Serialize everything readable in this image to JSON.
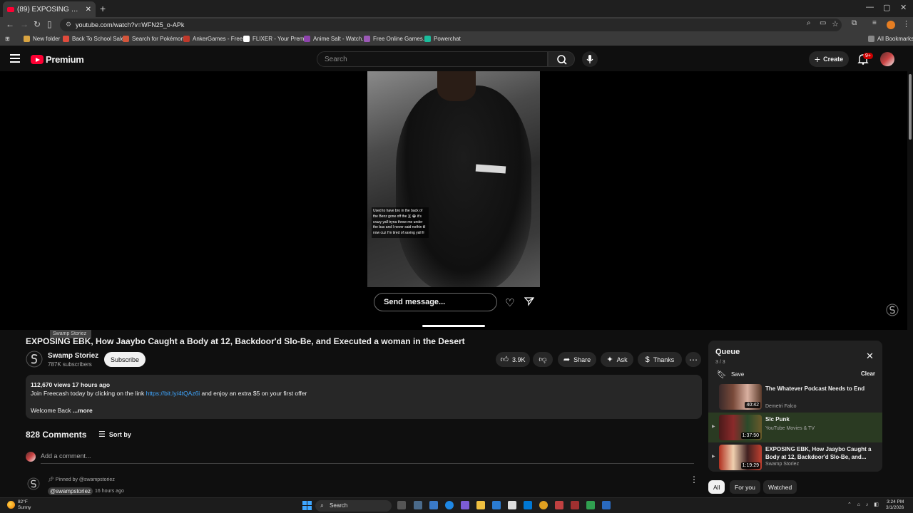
{
  "browser": {
    "tab_title": "(89) EXPOSING EBK, How Jaaybo Caug",
    "url": "youtube.com/watch?v=WFN25_o-APk",
    "new_tab_symbol": "+",
    "bookmarks": [
      {
        "label": "New folder",
        "color": "#d9a441"
      },
      {
        "label": "Back To School Sale...",
        "color": "#e04b3c"
      },
      {
        "label": "Search for Pokémon...",
        "color": "#d4553b"
      },
      {
        "label": "AnkerGames - Free...",
        "color": "#c0392b"
      },
      {
        "label": "FLIXER - Your Premi...",
        "color": "#ffffff"
      },
      {
        "label": "Anime Salt - Watch...",
        "color": "#8e44ad"
      },
      {
        "label": "Free Online Games...",
        "color": "#9b59b6"
      },
      {
        "label": "Powerchat",
        "color": "#1abc9c"
      }
    ],
    "all_bookmarks": "All Bookmarks"
  },
  "header": {
    "logo_text": "Premium",
    "search_placeholder": "Search",
    "create_label": "Create",
    "notifications_badge": "9+"
  },
  "player": {
    "caption": "Used to have bro in the back of the Benz gone off the 🇪 😂 it's crazy yall tryna throw me under the bus and I never said nothin til now cuz I'm tired of saving yall fr",
    "send_message": "Send message..."
  },
  "video": {
    "tooltip": "Swamp Storiez",
    "title": "EXPOSING EBK, How Jaaybo Caught a Body at 12, Backdoor'd Slo-Be, and Executed a woman in the Desert",
    "channel_name": "Swamp Storiez",
    "subscribers": "787K subscribers",
    "subscribe_label": "Subscribe",
    "likes": "3.9K",
    "share_label": "Share",
    "ask_label": "Ask",
    "thanks_label": "Thanks",
    "views": "112,670 views",
    "age": "17 hours ago",
    "desc_line1_pre": "Join Freecash today by clicking on the link ",
    "desc_link": "https://bit.ly/4tQAz6i",
    "desc_line1_post": " and enjoy an extra $5 on your first offer",
    "desc_line2": "Welcome Back",
    "desc_more": "...more"
  },
  "comments": {
    "count_label": "828 Comments",
    "sort_label": "Sort by",
    "add_placeholder": "Add a comment...",
    "pinned_label": "Pinned by @swampstoriez",
    "pinned_author": "@swampstoriez",
    "pinned_time": "16 hours ago"
  },
  "queue": {
    "title": "Queue",
    "position": "3 / 3",
    "save_label": "Save",
    "clear_label": "Clear",
    "items": [
      {
        "title": "The Whatever Podcast Needs to End",
        "author": "Demetri Falco",
        "duration": "40:42",
        "thumb": "#7a4a3a"
      },
      {
        "title": "Slc Punk",
        "author": "YouTube Movies & TV",
        "duration": "1:37:50",
        "thumb": "#8a2a2a"
      },
      {
        "title": "EXPOSING EBK, How Jaaybo Caught a Body at 12, Backdoor'd Slo-Be, and...",
        "author": "Swamp Storiez",
        "duration": "1:19:29",
        "thumb": "#b03020"
      }
    ]
  },
  "chips": [
    "All",
    "For you",
    "Watched"
  ],
  "taskbar": {
    "temp": "82°F",
    "weather": "Sunny",
    "search": "Search",
    "time": "3:24 PM",
    "date": "3/1/2026"
  }
}
